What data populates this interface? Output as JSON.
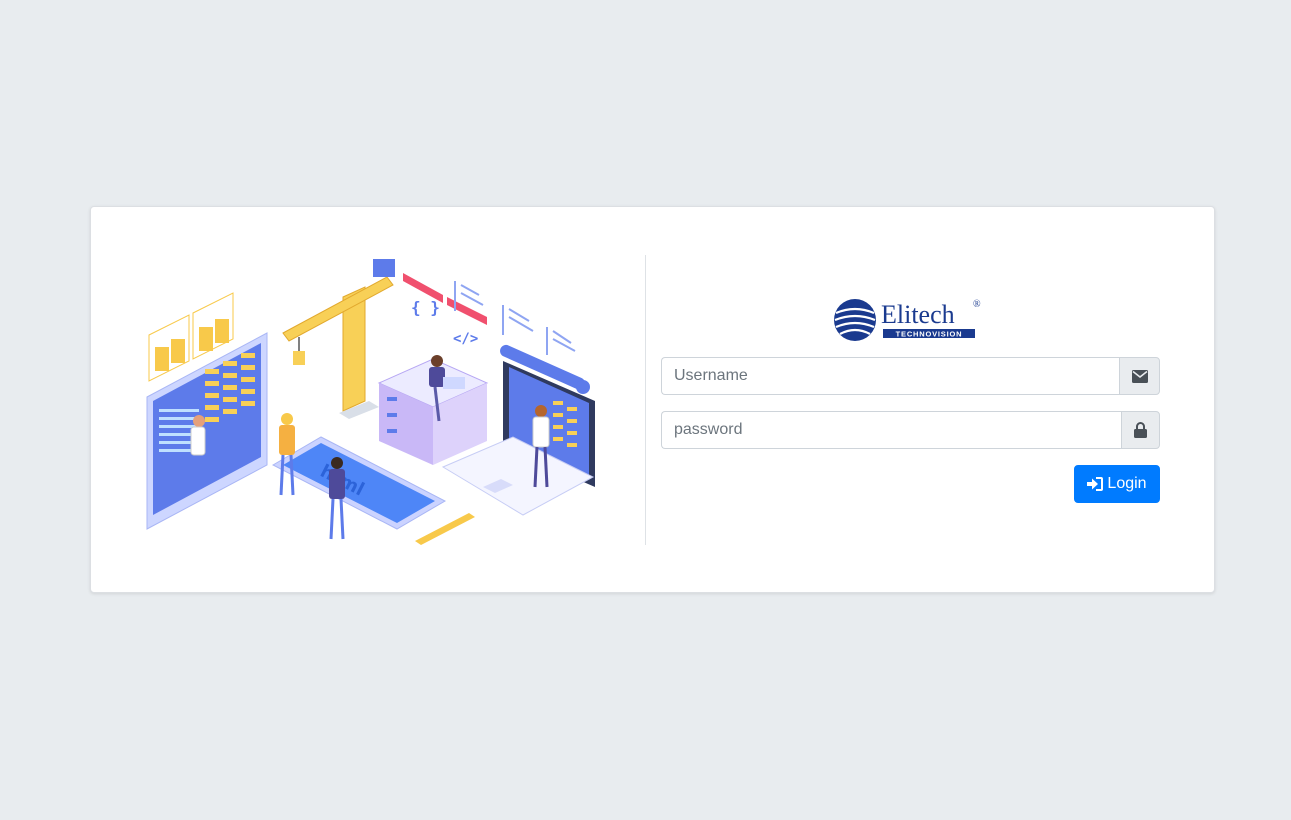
{
  "logo": {
    "wordmark": "Elitech",
    "tagline": "TECHNOVISION",
    "registered": "®"
  },
  "illustration": {
    "code_braces": "{ }",
    "code_tag": "</>",
    "html_label": "html"
  },
  "login_form": {
    "username": {
      "placeholder": "Username",
      "value": "",
      "icon": "envelope-icon"
    },
    "password": {
      "placeholder": "password",
      "value": "",
      "icon": "lock-icon"
    },
    "submit": {
      "label": "Login",
      "icon": "sign-in-icon"
    }
  },
  "colors": {
    "page_background": "#e8ecef",
    "primary": "#007bff",
    "logo_blue": "#1a3a8f",
    "addon_background": "#e9ecef"
  }
}
